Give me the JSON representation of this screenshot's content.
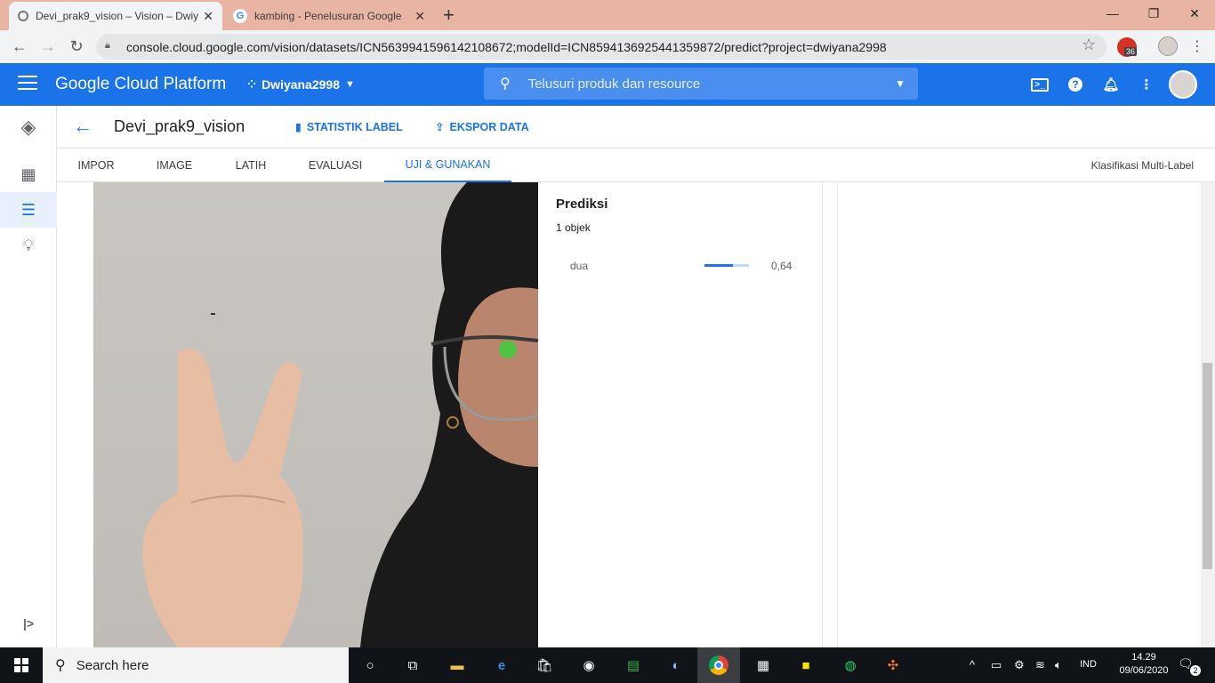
{
  "browser": {
    "tabs": [
      {
        "title": "Devi_prak9_vision – Vision – Dwiy",
        "active": true
      },
      {
        "title": "kambing - Penelusuran Google",
        "active": false
      }
    ],
    "new_tab": "+",
    "url": "console.cloud.google.com/vision/datasets/ICN5639941596142108672;modelId=ICN8594136925441359872/predict?project=dwiyana2998",
    "extension_badge": "36"
  },
  "gcp_header": {
    "title": "Google Cloud Platform",
    "project": "Dwiyana2998",
    "search_placeholder": "Telusuri produk dan resource"
  },
  "page": {
    "title": "Devi_prak9_vision",
    "actions": [
      "STATISTIK LABEL",
      "EKSPOR DATA"
    ],
    "tabs": [
      {
        "label": "IMPOR"
      },
      {
        "label": "IMAGE"
      },
      {
        "label": "LATIH"
      },
      {
        "label": "EVALUASI"
      },
      {
        "label": "UJI & GUNAKAN",
        "active": true
      }
    ],
    "type_label": "Klasifikasi Multi-Label"
  },
  "prediction": {
    "heading": "Prediksi",
    "count": "1 objek",
    "items": [
      {
        "label": "dua",
        "score": "0,64",
        "value": 0.64
      }
    ]
  },
  "taskbar": {
    "search_placeholder": "Search here",
    "language": "IND",
    "time": "14.29",
    "date": "09/06/2020",
    "notifications": "2"
  },
  "colors": {
    "gcp_blue": "#1a73e8",
    "tab_strip": "#e8b4a4",
    "taskbar": "#101418"
  }
}
